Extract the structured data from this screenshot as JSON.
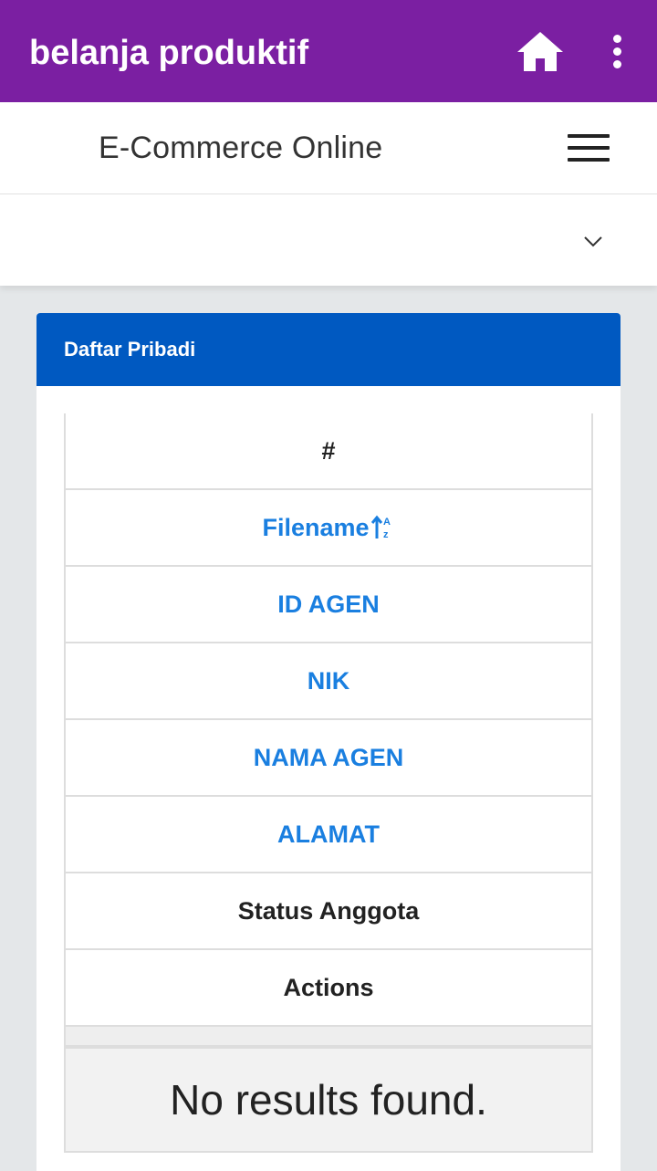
{
  "appbar": {
    "title": "belanja produktif",
    "home_icon": "home-icon",
    "menu_icon": "more-vert-icon",
    "color": "#7b1fa2"
  },
  "navbar": {
    "brand": "E-Commerce Online",
    "toggle_icon": "hamburger-icon"
  },
  "dropdown": {
    "icon": "chevron-down-icon"
  },
  "panel": {
    "title": "Daftar Pribadi",
    "header_color": "#0059c1",
    "table": {
      "columns": [
        {
          "label": "#",
          "sortable": false
        },
        {
          "label": "Filename",
          "sortable": true,
          "sort_icon": "sort-alpha-asc-icon"
        },
        {
          "label": "ID AGEN",
          "sortable": true
        },
        {
          "label": "NIK",
          "sortable": true
        },
        {
          "label": "NAMA AGEN",
          "sortable": true
        },
        {
          "label": "ALAMAT",
          "sortable": true
        },
        {
          "label": "Status Anggota",
          "sortable": false
        },
        {
          "label": "Actions",
          "sortable": false
        }
      ],
      "empty_message": "No results found.",
      "link_color": "#1a7fe0"
    }
  }
}
